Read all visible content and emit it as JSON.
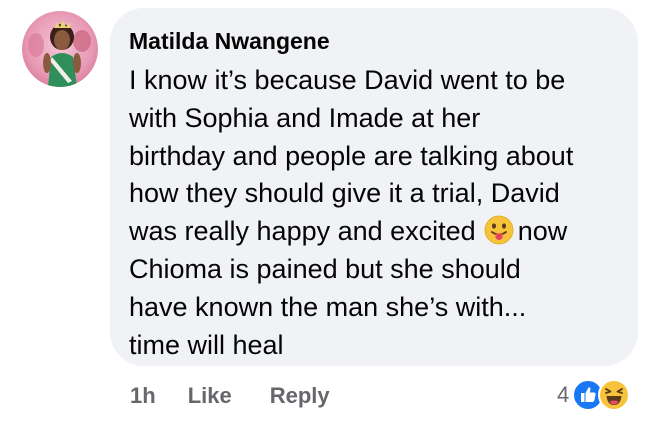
{
  "comment": {
    "author": "Matilda Nwangene",
    "avatar_icon": "profile-photo-avatar",
    "text_lines": [
      "I know it’s because David went to be",
      "with Sophia and Imade at her",
      "birthday and people are talking about",
      "how they should give it a trial, David",
      "was really happy and excited",
      "now",
      "Chioma is pained but she should",
      "have known the man she’s with...",
      "time will heal"
    ],
    "inline_emoji": "face-with-tongue-emoji"
  },
  "actions": {
    "time": "1h",
    "like_label": "Like",
    "reply_label": "Reply"
  },
  "reactions": {
    "count": "4",
    "types": [
      "like-reaction-icon",
      "haha-reaction-icon"
    ]
  },
  "colors": {
    "bubble_bg": "#f0f2f5",
    "secondary_text": "#65676b",
    "like_blue": "#1877f2",
    "emoji_yellow": "#f7c33b"
  }
}
